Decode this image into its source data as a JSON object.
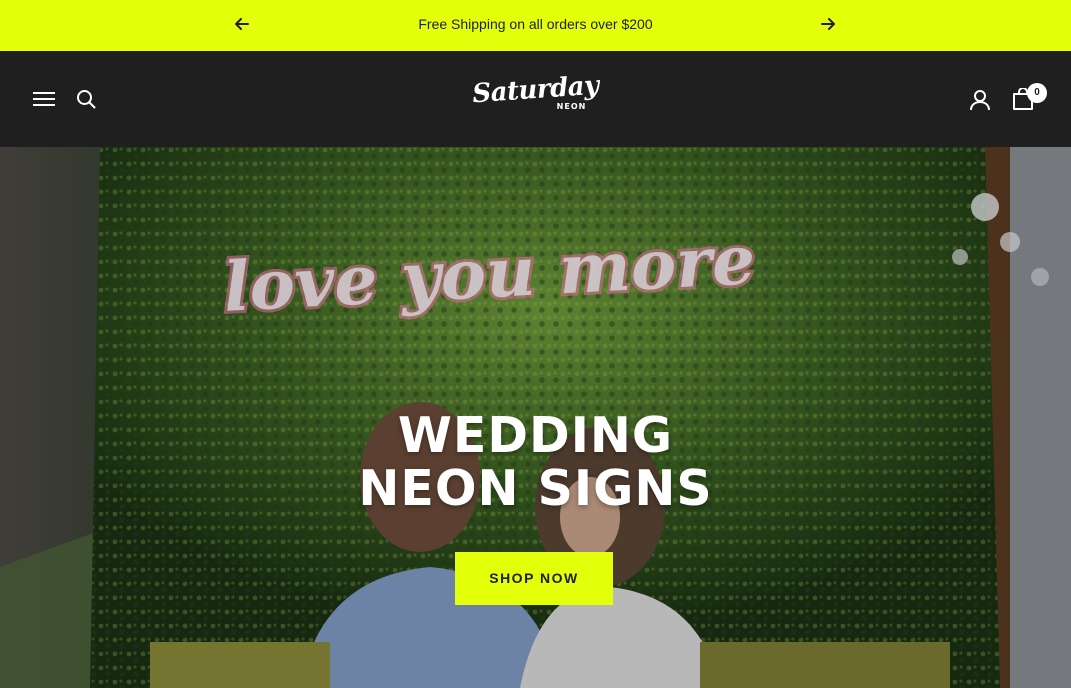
{
  "colors": {
    "accent": "#e4ff0a",
    "header_bg": "#1f1f1f",
    "neon_pink": "#ff7fb0",
    "foliage_dark": "#1f3a17",
    "foliage_light": "#4f7a2c"
  },
  "announcement": {
    "text": "Free Shipping on all orders over $200",
    "prev_icon": "arrow-left-icon",
    "next_icon": "arrow-right-icon"
  },
  "header": {
    "logo_script": "Saturday",
    "logo_sub": "NEON",
    "menu_icon": "hamburger-menu-icon",
    "search_icon": "search-icon",
    "account_icon": "user-icon",
    "cart_icon": "cart-icon",
    "cart_count": "0"
  },
  "hero": {
    "neon_text": "love you more",
    "title_line1": "WEDDING",
    "title_line2": "NEON SIGNS",
    "cta_label": "SHOP NOW"
  }
}
